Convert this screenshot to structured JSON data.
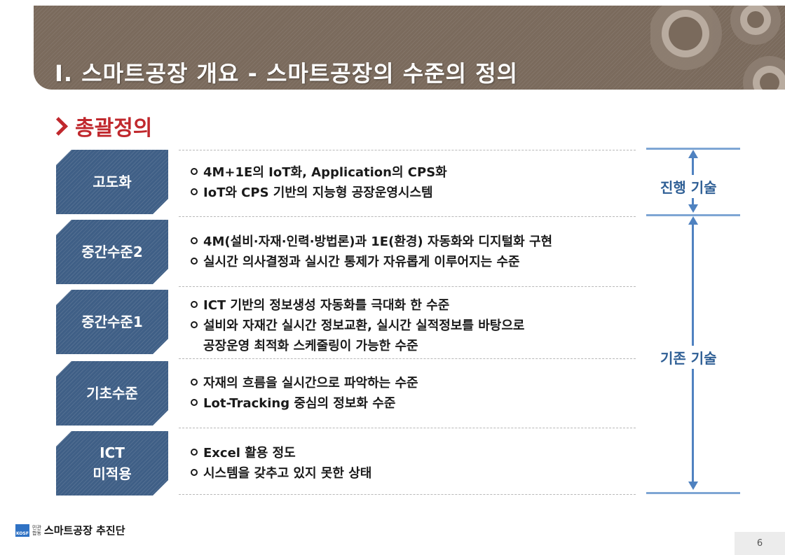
{
  "header": {
    "title": "I. 스마트공장 개요 - 스마트공장의 수준의 정의"
  },
  "section": {
    "title": "총괄정의"
  },
  "levels": [
    {
      "name": "고도화",
      "bullets": [
        "4M+1E의 IoT화, Application의 CPS화",
        "IoT와 CPS 기반의 지능형 공장운영시스템"
      ]
    },
    {
      "name": "중간수준2",
      "bullets": [
        "4M(설비·자재·인력·방법론)과 1E(환경) 자동화와 디지털화 구현",
        "실시간 의사결정과 실시간 통제가 자유롭게 이루어지는 수준"
      ]
    },
    {
      "name": "중간수준1",
      "bullets": [
        "ICT 기반의 정보생성 자동화를 극대화 한 수준",
        "설비와 자재간 실시간 정보교환, 실시간 실적정보를 바탕으로\n공장운영 최적화 스케줄링이 가능한 수준"
      ]
    },
    {
      "name": "기초수준",
      "bullets": [
        "자재의 흐름을 실시간으로 파악하는 수준",
        "Lot-Tracking 중심의 정보화 수준"
      ]
    },
    {
      "name": "ICT\n미적용",
      "bullets": [
        "Excel 활용 정도",
        "시스템을 갖추고 있지 못한 상태"
      ]
    }
  ],
  "tech": {
    "advanced": "진행 기술",
    "existing": "기존 기술"
  },
  "footer": {
    "logo_text": "KOSF",
    "tag": "민관\n합동",
    "org": "스마트공장 추진단",
    "page": "6"
  },
  "colors": {
    "header": "#7a6a5c",
    "accent_red": "#c0282d",
    "level_box": "#3f5f86",
    "tech_blue": "#4f82c0"
  }
}
